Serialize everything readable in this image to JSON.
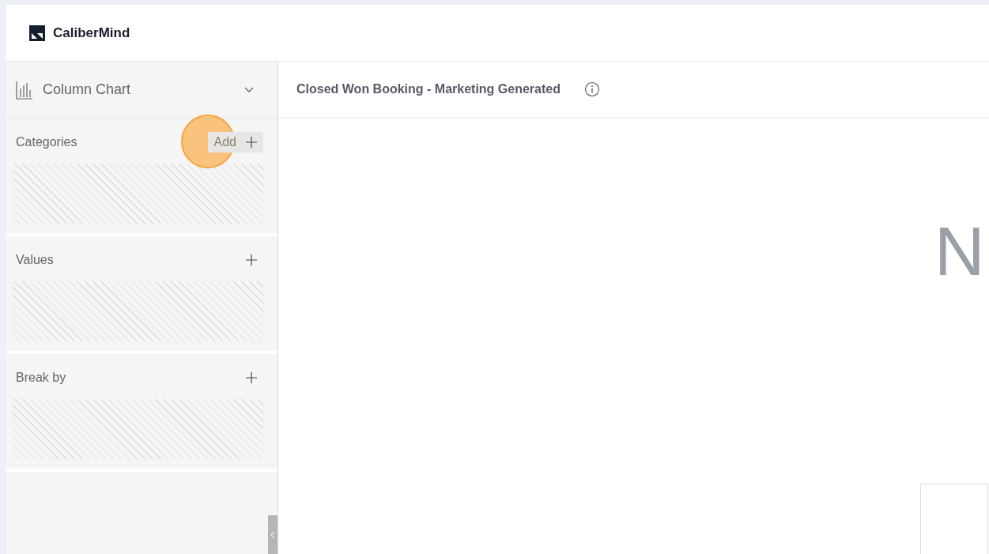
{
  "brand": {
    "name": "CaliberMind"
  },
  "chart_type": {
    "label": "Column Chart"
  },
  "sections": [
    {
      "title": "Categories",
      "add_label": "Add",
      "hovered": true
    },
    {
      "title": "Values",
      "hovered": false
    },
    {
      "title": "Break by",
      "hovered": false
    }
  ],
  "widget": {
    "title": "Closed Won Booking - Marketing Generated"
  },
  "canvas": {
    "large_text": "N"
  }
}
